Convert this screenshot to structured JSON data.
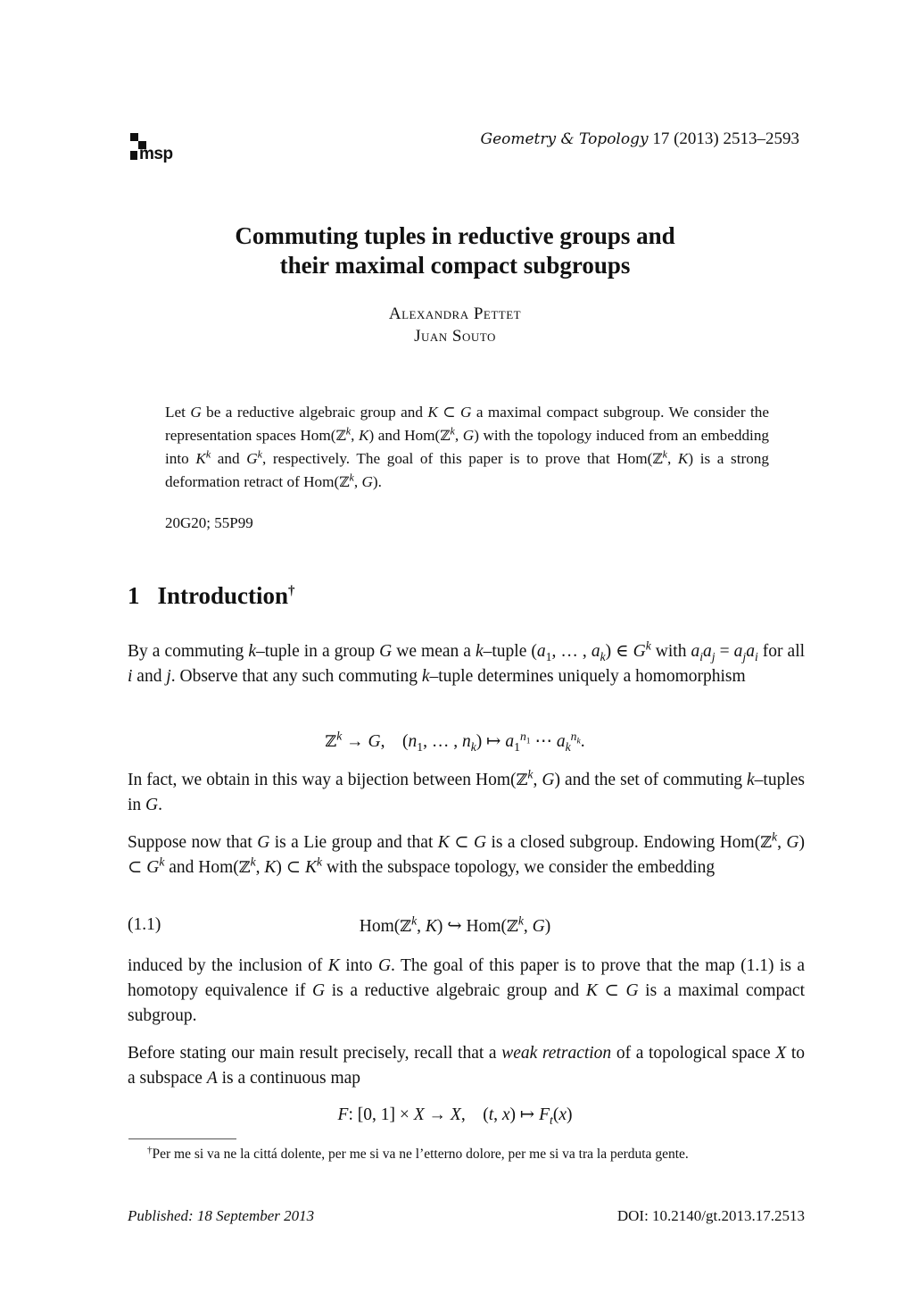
{
  "header": {
    "logo_text": "msp",
    "journal_name": "Geometry & Topology",
    "journal_volume": "17 (2013) 2513–2593"
  },
  "title": {
    "line1": "Commuting tuples in reductive groups and",
    "line2": "their maximal compact subgroups"
  },
  "authors": [
    "Alexandra Pettet",
    "Juan Souto"
  ],
  "abstract": {
    "text_html": "Let <i class=\"m\">G</i> be a reductive algebraic group and <i class=\"m\">K</i> ⊂ <i class=\"m\">G</i> a maximal compact subgroup. We consider the representation spaces Hom(<span class=\"bb\">ℤ</span><sup><i class=\"m\">k</i></sup>, <i class=\"m\">K</i>) and Hom(<span class=\"bb\">ℤ</span><sup><i class=\"m\">k</i></sup>, <i class=\"m\">G</i>) with the topology induced from an embedding into <i class=\"m\">K</i><sup><i class=\"m\">k</i></sup> and <i class=\"m\">G</i><sup><i class=\"m\">k</i></sup>, respectively. The goal of this paper is to prove that Hom(<span class=\"bb\">ℤ</span><sup><i class=\"m\">k</i></sup>, <i class=\"m\">K</i>) is a strong deformation retract of Hom(<span class=\"bb\">ℤ</span><sup><i class=\"m\">k</i></sup>, <i class=\"m\">G</i>)."
  },
  "msc_codes": "20G20; 55P99",
  "section": {
    "number": "1",
    "title": "Introduction",
    "footnote_mark": "†"
  },
  "paragraphs": {
    "p1_html": "By a commuting <i class=\"m\">k</i>–tuple in a group <i class=\"m\">G</i> we mean a <i class=\"m\">k</i>–tuple (<i class=\"m\">a</i><sub>1</sub>, … , <i class=\"m\">a<sub>k</sub></i>) ∈ <i class=\"m\">G</i><sup><i class=\"m\">k</i></sup> with <i class=\"m\">a<sub>i</sub>a<sub>j</sub></i> = <i class=\"m\">a<sub>j</sub>a<sub>i</sub></i> for all <i class=\"m\">i</i> and <i class=\"m\">j</i>. Observe that any such commuting <i class=\"m\">k</i>–tuple determines uniquely a homomorphism",
    "eq1_html": "<span class=\"bb\">ℤ</span><sup><i class=\"m\">k</i></sup> → <i class=\"m\">G</i>, &nbsp;&nbsp;&nbsp;(<i class=\"m\">n</i><sub>1</sub>, … , <i class=\"m\">n<sub>k</sub></i>) ↦ <i class=\"m\">a</i><sub>1</sub><sup><i class=\"m\">n</i><sub>1</sub></sup> ⋯ <i class=\"m\">a<sub>k</sub><sup>n<sub>k</sub></sup></i>.",
    "p2_html": "In fact, we obtain in this way a bijection between Hom(<span class=\"bb\">ℤ</span><sup><i class=\"m\">k</i></sup>, <i class=\"m\">G</i>) and the set of commuting <i class=\"m\">k</i>–tuples in <i class=\"m\">G</i>.",
    "p3_html": "Suppose now that <i class=\"m\">G</i> is a Lie group and that <i class=\"m\">K</i> ⊂ <i class=\"m\">G</i> is a closed subgroup. Endowing Hom(<span class=\"bb\">ℤ</span><sup><i class=\"m\">k</i></sup>, <i class=\"m\">G</i>) ⊂ <i class=\"m\">G</i><sup><i class=\"m\">k</i></sup> and Hom(<span class=\"bb\">ℤ</span><sup><i class=\"m\">k</i></sup>, <i class=\"m\">K</i>) ⊂ <i class=\"m\">K</i><sup><i class=\"m\">k</i></sup> with the subspace topology, we consider the embedding",
    "eq2_label": "(1.1)",
    "eq2_html": "Hom(<span class=\"bb\">ℤ</span><sup><i class=\"m\">k</i></sup>, <i class=\"m\">K</i>) ↪ Hom(<span class=\"bb\">ℤ</span><sup><i class=\"m\">k</i></sup>, <i class=\"m\">G</i>)",
    "p4_html": "induced by the inclusion of <i class=\"m\">K</i> into <i class=\"m\">G</i>. The goal of this paper is to prove that the map (1.1) is a homotopy equivalence if <i class=\"m\">G</i> is a reductive algebraic group and <i class=\"m\">K</i> ⊂ <i class=\"m\">G</i> is a maximal compact subgroup.",
    "p5_html": "Before stating our main result precisely, recall that a <i>weak retraction</i> of a topological space <i class=\"m\">X</i> to a subspace <i class=\"m\">A</i> is a continuous map",
    "eq3_html": "<i class=\"m\">F</i>: [0, 1] × <i class=\"m\">X</i> → <i class=\"m\">X</i>, &nbsp;&nbsp;&nbsp;(<i class=\"m\">t</i>, <i class=\"m\">x</i>) ↦ <i class=\"m\">F<sub>t</sub></i>(<i class=\"m\">x</i>)"
  },
  "footnote": {
    "mark": "†",
    "text": "Per me si va ne la cittá dolente, per me si va ne l’etterno dolore, per me si va tra la perduta gente."
  },
  "footer": {
    "published": "Published: 18 September 2013",
    "doi": "DOI: 10.2140/gt.2013.17.2513"
  }
}
